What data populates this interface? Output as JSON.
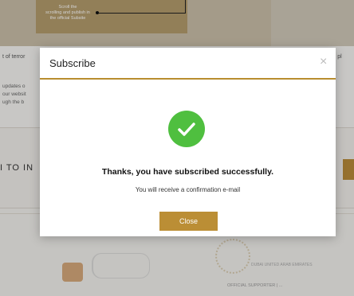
{
  "background": {
    "hint_text": "Scroll the\nscrolling and publish in\nthe official Subsite",
    "left_snippet": "t of terror",
    "right_snippet": "es, pl",
    "side_lines": [
      "updates o",
      "our websit",
      "ugh the b"
    ],
    "band_label": "I TO IN",
    "supporter_text": "OFFICIAL SUPPORTER | ...",
    "expo_text": "DUBAI UNITED ARAB EMIRATES"
  },
  "modal": {
    "title": "Subscribe",
    "close_icon": "×",
    "success_icon": "check-circle-icon",
    "message": "Thanks, you have subscribed successfully.",
    "sub_message": "You will receive a confirmation e-mail",
    "close_button": "Close"
  },
  "colors": {
    "accent": "#bb8e35",
    "success": "#4fbf3f"
  }
}
